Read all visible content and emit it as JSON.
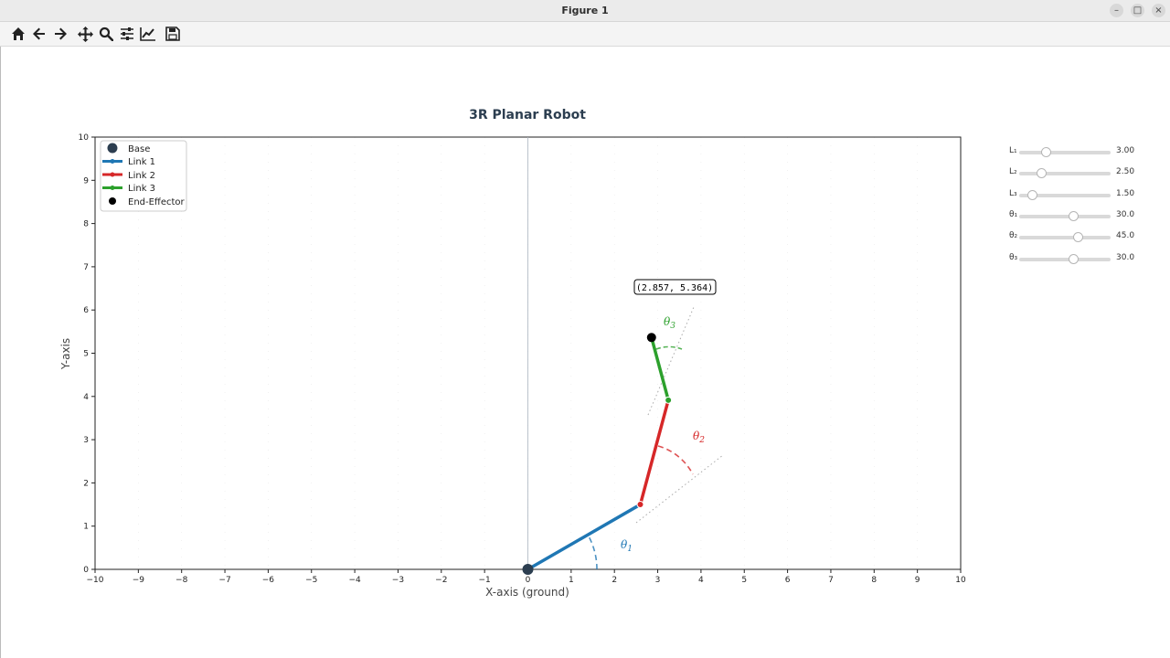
{
  "window": {
    "title": "Figure 1"
  },
  "toolbar": [
    {
      "name": "home-icon",
      "label": "Home"
    },
    {
      "name": "back-icon",
      "label": "Back"
    },
    {
      "name": "forward-icon",
      "label": "Forward"
    },
    {
      "name": "pan-icon",
      "label": "Pan"
    },
    {
      "name": "zoom-icon",
      "label": "Zoom"
    },
    {
      "name": "configure-subplots-icon",
      "label": "Subplots"
    },
    {
      "name": "edit-axes-icon",
      "label": "Customize"
    },
    {
      "name": "save-icon",
      "label": "Save"
    }
  ],
  "chart_data": {
    "type": "line",
    "title": "3R Planar Robot",
    "xlabel": "X-axis (ground)",
    "ylabel": "Y-axis",
    "xlim": [
      -10,
      10
    ],
    "ylim": [
      0,
      10
    ],
    "xticks": [
      "−10",
      "−9",
      "−8",
      "−7",
      "−6",
      "−5",
      "−4",
      "−3",
      "−2",
      "−1",
      "0",
      "1",
      "2",
      "3",
      "4",
      "5",
      "6",
      "7",
      "8",
      "9",
      "10"
    ],
    "yticks": [
      "0",
      "1",
      "2",
      "3",
      "4",
      "5",
      "6",
      "7",
      "8",
      "9",
      "10"
    ],
    "legend_position": "top-left",
    "legend": [
      {
        "label": "Base",
        "color": "#2c3e50",
        "style": "big-dot"
      },
      {
        "label": "Link 1",
        "color": "#1f77b4",
        "style": "line-dot"
      },
      {
        "label": "Link 2",
        "color": "#d62728",
        "style": "line-dot"
      },
      {
        "label": "Link 3",
        "color": "#2ca02c",
        "style": "line-dot"
      },
      {
        "label": "End-Effector",
        "color": "#000000",
        "style": "dot"
      }
    ],
    "joints": [
      {
        "name": "Base",
        "x": 0,
        "y": 0
      },
      {
        "name": "Joint 2",
        "x": 2.598,
        "y": 1.5
      },
      {
        "name": "Joint 3",
        "x": 3.245,
        "y": 3.915
      },
      {
        "name": "End-Effector",
        "x": 2.857,
        "y": 5.364
      }
    ],
    "series": [
      {
        "name": "Link 1",
        "color": "#1f77b4",
        "x": [
          0,
          2.598
        ],
        "y": [
          0,
          1.5
        ]
      },
      {
        "name": "Link 2",
        "color": "#d62728",
        "x": [
          2.598,
          3.245
        ],
        "y": [
          1.5,
          3.915
        ]
      },
      {
        "name": "Link 3",
        "color": "#2ca02c",
        "x": [
          3.245,
          2.857
        ],
        "y": [
          3.915,
          5.364
        ]
      }
    ],
    "angle_labels": [
      {
        "text": "θ",
        "sub": "1",
        "color": "#1f77b4"
      },
      {
        "text": "θ",
        "sub": "2",
        "color": "#d62728"
      },
      {
        "text": "θ",
        "sub": "3",
        "color": "#2ca02c"
      }
    ],
    "annotation": "(2.857, 5.364)",
    "colors": {
      "base": "#2c3e50",
      "link1": "#1f77b4",
      "link2": "#d62728",
      "link3": "#2ca02c",
      "ee": "#000000"
    }
  },
  "sliders": [
    {
      "label": "L₁",
      "value": "3.00",
      "min": 0,
      "max": 10,
      "fraction": 0.3
    },
    {
      "label": "L₂",
      "value": "2.50",
      "min": 0,
      "max": 10,
      "fraction": 0.25
    },
    {
      "label": "L₃",
      "value": "1.50",
      "min": 0,
      "max": 10,
      "fraction": 0.15
    },
    {
      "label": "θ₁",
      "value": "30.0",
      "fraction": 0.6
    },
    {
      "label": "θ₂",
      "value": "45.0",
      "fraction": 0.65
    },
    {
      "label": "θ₃",
      "value": "30.0",
      "fraction": 0.6
    }
  ]
}
